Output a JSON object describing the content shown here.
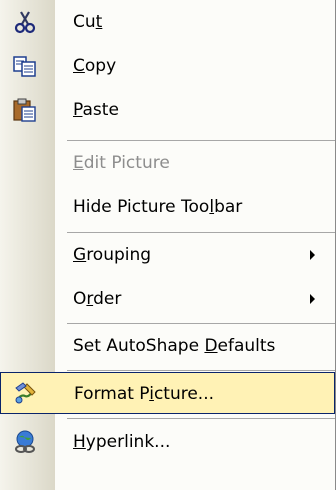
{
  "menu": {
    "items": [
      {
        "pre": "Cu",
        "key": "t",
        "post": "",
        "icon": "scissors-icon"
      },
      {
        "pre": "",
        "key": "C",
        "post": "opy",
        "icon": "copy-icon"
      },
      {
        "pre": "",
        "key": "P",
        "post": "aste",
        "icon": "paste-icon"
      },
      {
        "pre": "",
        "key": "E",
        "post": "dit Picture",
        "disabled": true
      },
      {
        "pre": "Hide Picture Too",
        "key": "l",
        "post": "bar"
      },
      {
        "pre": "",
        "key": "G",
        "post": "rouping",
        "submenu": true
      },
      {
        "pre": "O",
        "key": "r",
        "post": "der",
        "submenu": true
      },
      {
        "pre": "Set AutoShape ",
        "key": "D",
        "post": "efaults"
      },
      {
        "pre": "Format P",
        "key": "i",
        "post": "cture...",
        "icon": "format-picture-icon",
        "highlighted": true
      },
      {
        "pre": "",
        "key": "H",
        "post": "yperlink...",
        "icon": "hyperlink-icon"
      }
    ]
  }
}
